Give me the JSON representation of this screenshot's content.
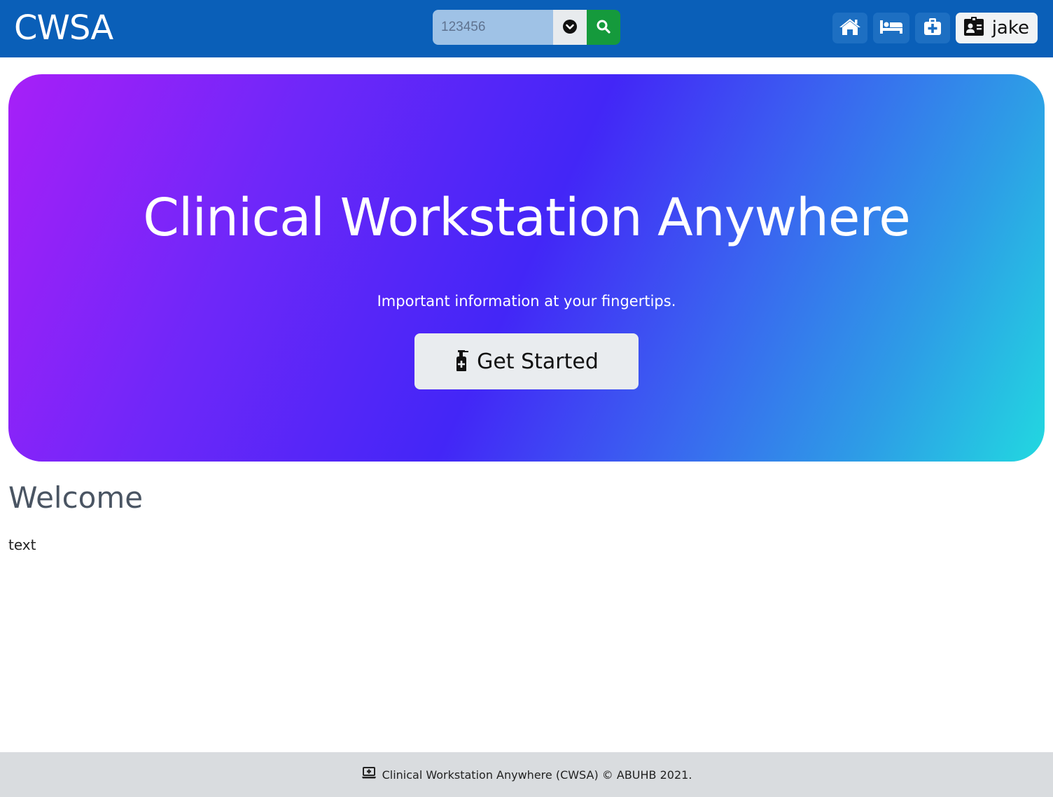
{
  "header": {
    "brand": "CWSA",
    "search": {
      "value": "",
      "placeholder": "123456"
    },
    "icons": [
      "home-icon",
      "bed-icon",
      "medkit-icon",
      "id-badge-icon"
    ],
    "user": {
      "name": "jake"
    }
  },
  "hero": {
    "title": "Clinical Workstation Anywhere",
    "subtitle": "Important information at your fingertips.",
    "button_label": "Get Started"
  },
  "main": {
    "heading": "Welcome",
    "body": "text"
  },
  "footer": {
    "text": "Clinical Workstation Anywhere (CWSA) © ABUHB 2021."
  },
  "colors": {
    "navbar": "#0a5fb8",
    "search_button": "#159a3c",
    "footer": "#d9dcdf"
  }
}
